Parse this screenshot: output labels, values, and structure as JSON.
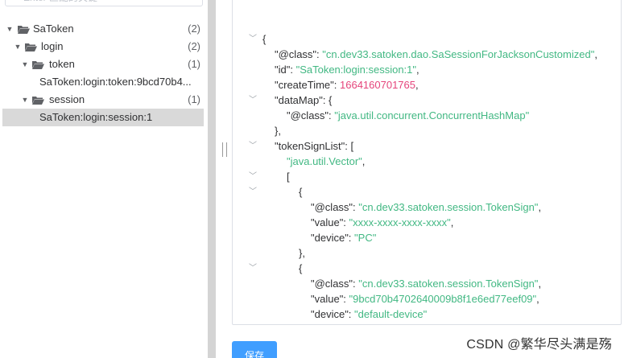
{
  "search": {
    "placeholder": "Enter 匹配的关键"
  },
  "tree": [
    {
      "label": "SaToken",
      "count": "(2)",
      "expanded": true
    },
    {
      "label": "login",
      "count": "(2)",
      "expanded": true
    },
    {
      "label": "token",
      "count": "(1)",
      "expanded": true
    },
    {
      "label": "SaToken:login:token:9bcd70b4..."
    },
    {
      "label": "session",
      "count": "(1)",
      "expanded": true
    },
    {
      "label": "SaToken:login:session:1",
      "selected": true
    }
  ],
  "json": {
    "open_brace": "{",
    "class_key": "\"@class\": ",
    "class_val": "\"cn.dev33.satoken.dao.SaSessionForJacksonCustomized\"",
    "id_key": "\"id\": ",
    "id_val": "\"SaToken:login:session:1\"",
    "createTime_key": "\"createTime\": ",
    "createTime_val": "1664160701765",
    "dataMap_key": "\"dataMap\": {",
    "dataMap_class_key": "\"@class\": ",
    "dataMap_class_val": "\"java.util.concurrent.ConcurrentHashMap\"",
    "close_obj_comma": "},",
    "tokenSignList_key": "\"tokenSignList\": [",
    "vector_val": "\"java.util.Vector\"",
    "open_bracket": "[",
    "open_obj": "{",
    "ts_class_key": "\"@class\": ",
    "ts_class_val": "\"cn.dev33.satoken.session.TokenSign\"",
    "value_key": "\"value\": ",
    "value1": "\"xxxx-xxxx-xxxx-xxxx\"",
    "device_key": "\"device\": ",
    "device1": "\"PC\"",
    "value2": "\"9bcd70b4702640009b8f1e6ed77eef09\"",
    "device2": "\"default-device\"",
    "comma": ","
  },
  "actions": {
    "save_label": "保存"
  },
  "watermark": "CSDN @繁华尽头满是殇",
  "colors": {
    "string": "#42b883",
    "number": "#e5447b",
    "primary": "#409eff",
    "selected": "#d9d9d9"
  }
}
